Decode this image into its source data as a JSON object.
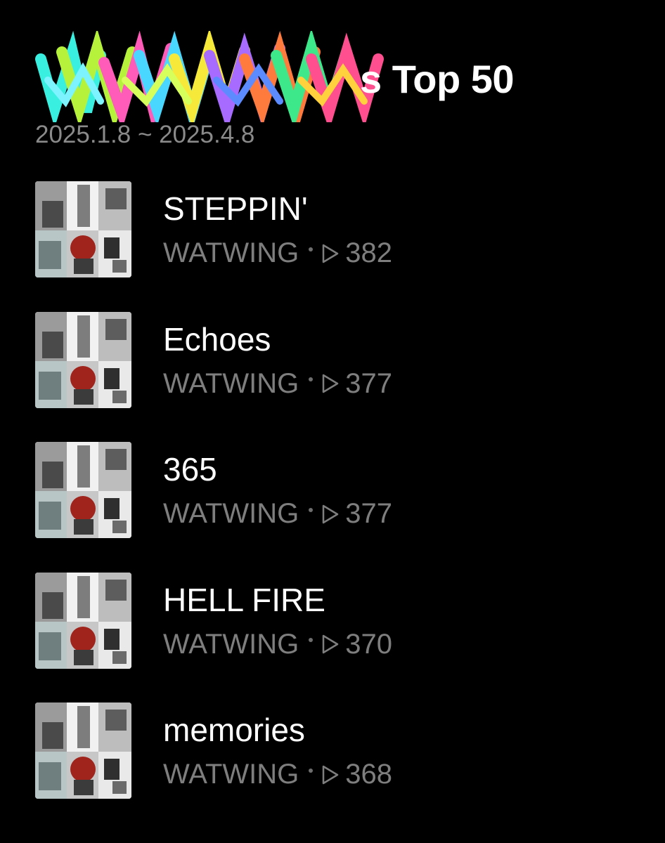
{
  "header": {
    "title_suffix": "s Top 50",
    "date_range": "2025.1.8 ~ 2025.4.8"
  },
  "tracks": [
    {
      "title": "STEPPIN'",
      "artist": "WATWING",
      "plays": "382"
    },
    {
      "title": "Echoes",
      "artist": "WATWING",
      "plays": "377"
    },
    {
      "title": "365",
      "artist": "WATWING",
      "plays": "377"
    },
    {
      "title": "HELL FIRE",
      "artist": "WATWING",
      "plays": "370"
    },
    {
      "title": "memories",
      "artist": "WATWING",
      "plays": "368"
    }
  ],
  "icons": {
    "play": "play-outline-icon",
    "cover": "album-cover-collage"
  },
  "colors": {
    "background": "#000000",
    "title": "#ffffff",
    "secondary": "#7e7e7e"
  }
}
